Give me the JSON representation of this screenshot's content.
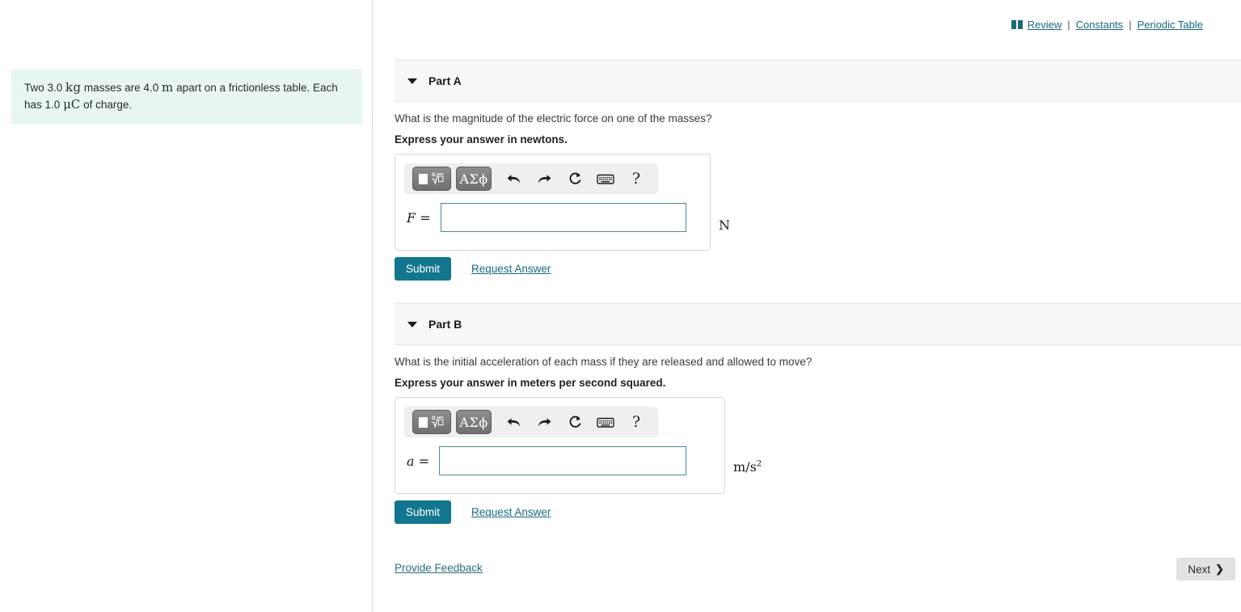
{
  "top_links": {
    "book_icon": "book-icon",
    "review": "Review",
    "constants": "Constants",
    "periodic_table": "Periodic Table",
    "separator": "|"
  },
  "problem": {
    "text_1": "Two 3.0",
    "unit_kg": "kg",
    "text_2": "masses are 4.0",
    "unit_m": "m",
    "text_3": "apart on a frictionless table. Each has 1.0",
    "unit_uc": "μC",
    "text_4": "of charge."
  },
  "toolbar": {
    "math_template_label": "",
    "greek_label": "ΑΣϕ",
    "undo": "↶",
    "redo": "↷",
    "reset": "↺",
    "keyboard": "keyboard",
    "help": "?"
  },
  "parts": [
    {
      "title": "Part A",
      "question": "What is the magnitude of the electric force on one of the masses?",
      "express": "Express your answer in newtons.",
      "answer_symbol": "F",
      "answer_equals": "=",
      "answer_value": "",
      "answer_unit": "N",
      "answer_unit_sup": "",
      "submit_label": "Submit",
      "request_label": "Request Answer"
    },
    {
      "title": "Part B",
      "question": "What is the initial acceleration of each mass if they are released and allowed to move?",
      "express": "Express your answer in meters per second squared.",
      "answer_symbol": "a",
      "answer_equals": "=",
      "answer_value": "",
      "answer_unit": "m/s",
      "answer_unit_sup": "2",
      "submit_label": "Submit",
      "request_label": "Request Answer"
    }
  ],
  "footer": {
    "feedback": "Provide Feedback",
    "next": "Next",
    "next_chevron": "❯"
  },
  "colors": {
    "accent_teal": "#12778e",
    "link_teal": "#17697c",
    "problem_bg": "#e8f6f3",
    "header_band": "#f7f7f7",
    "input_border": "#4a8b99"
  }
}
